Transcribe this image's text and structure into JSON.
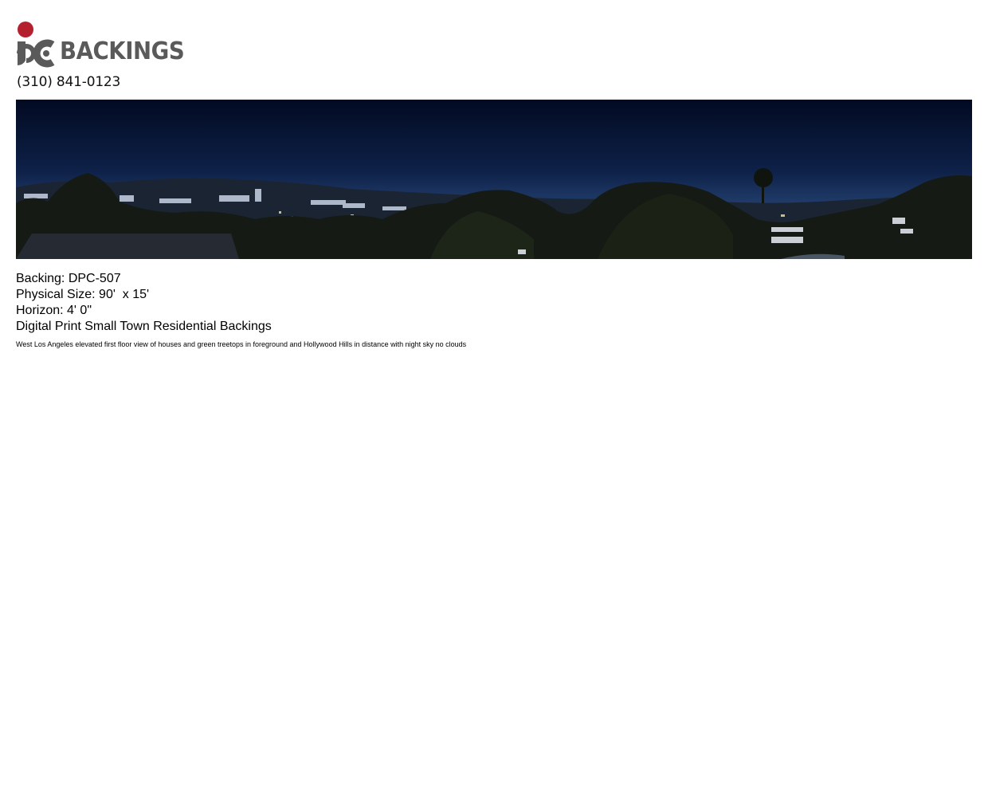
{
  "brand": {
    "logo_text": "BACKINGS",
    "logo_mark": "jc-logo-mark",
    "colors": {
      "dot": "#b5202e",
      "gray": "#5a5a5a"
    }
  },
  "contact": {
    "phone": "(310) 841-0123"
  },
  "banner": {
    "subject": "night-skyline-photo",
    "colors": {
      "sky_top": "#020a22",
      "sky_horizon": "#2a4677",
      "hills": "#1b2433",
      "trees": "#151a14"
    }
  },
  "details": {
    "backing": "Backing: DPC-507",
    "physical_size": "Physical Size: 90'  x 15'",
    "horizon": "Horizon: 4' 0\"",
    "category": "Digital Print Small Town Residential Backings"
  },
  "description": "West Los Angeles elevated first floor view of houses and green treetops in foreground and Hollywood Hills in distance with night sky no clouds"
}
